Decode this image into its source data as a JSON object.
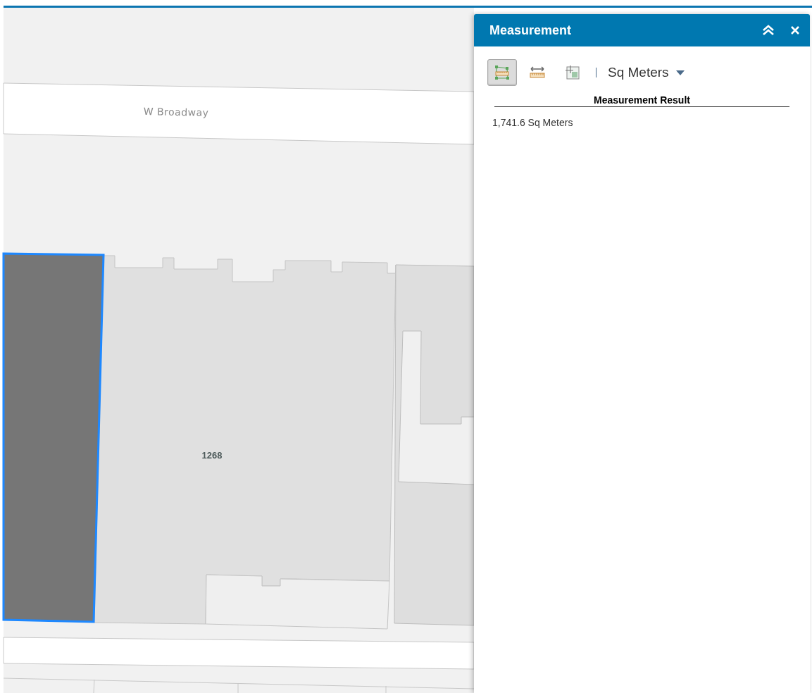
{
  "map": {
    "labels": [
      {
        "kind": "street",
        "text": "W Broadway"
      },
      {
        "kind": "parcel",
        "text": "1268"
      }
    ]
  },
  "panel": {
    "title": "Measurement",
    "tools": [
      {
        "kind": "area",
        "selected": true
      },
      {
        "kind": "distance",
        "selected": false
      },
      {
        "kind": "location",
        "selected": false
      }
    ],
    "unit": "Sq Meters",
    "result_heading": "Measurement Result",
    "result": "1,741.6 Sq Meters"
  }
}
